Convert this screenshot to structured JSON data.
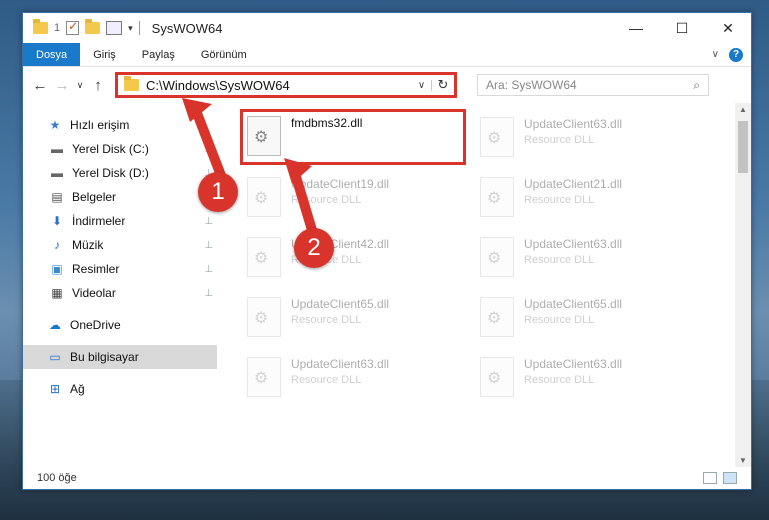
{
  "window": {
    "title": "SysWOW64",
    "qa_sep": "1",
    "controls": {
      "minimize": "—",
      "maximize": "☐",
      "close": "✕"
    }
  },
  "ribbon": {
    "tabs": [
      "Dosya",
      "Giriş",
      "Paylaş",
      "Görünüm"
    ],
    "expand": "∨",
    "help": "?"
  },
  "address": {
    "back": "←",
    "forward": "→",
    "recent": "∨",
    "up": "↑",
    "path": "C:\\Windows\\SysWOW64",
    "dropdown": "∨",
    "refresh": "↻",
    "search_placeholder": "Ara: SysWOW64",
    "search_icon": "⌕"
  },
  "sidebar": {
    "items": [
      {
        "label": "Hızlı erişim",
        "icon": "star-icon"
      },
      {
        "label": "Yerel Disk (C:)",
        "icon": "drive-icon"
      },
      {
        "label": "Yerel Disk (D:)",
        "icon": "drive-icon"
      },
      {
        "label": "Belgeler",
        "icon": "documents-icon"
      },
      {
        "label": "İndirmeler",
        "icon": "download-icon"
      },
      {
        "label": "Müzik",
        "icon": "music-icon"
      },
      {
        "label": "Resimler",
        "icon": "pictures-icon"
      },
      {
        "label": "Videolar",
        "icon": "videos-icon"
      },
      {
        "label": "OneDrive",
        "icon": "cloud-icon"
      },
      {
        "label": "Bu bilgisayar",
        "icon": "computer-icon"
      },
      {
        "label": "Ağ",
        "icon": "network-icon"
      }
    ]
  },
  "files": [
    {
      "name": "fmdbms32.dll",
      "type": ""
    },
    {
      "name": "UpdateClient63.dll",
      "type": "Resource DLL"
    },
    {
      "name": "UpdateClient19.dll",
      "type": "Resource DLL"
    },
    {
      "name": "UpdateClient21.dll",
      "type": "Resource DLL"
    },
    {
      "name": "UpdateClient42.dll",
      "type": "Resource DLL"
    },
    {
      "name": "UpdateClient63.dll",
      "type": "Resource DLL"
    },
    {
      "name": "UpdateClient65.dll",
      "type": "Resource DLL"
    },
    {
      "name": "UpdateClient65.dll",
      "type": "Resource DLL"
    },
    {
      "name": "UpdateClient63.dll",
      "type": "Resource DLL"
    },
    {
      "name": "UpdateClient63.dll",
      "type": "Resource DLL"
    }
  ],
  "status": {
    "count": "100 öğe"
  },
  "callouts": {
    "step1": "1",
    "step2": "2"
  },
  "colors": {
    "accent": "#1979ca",
    "highlight": "#d9342b"
  }
}
